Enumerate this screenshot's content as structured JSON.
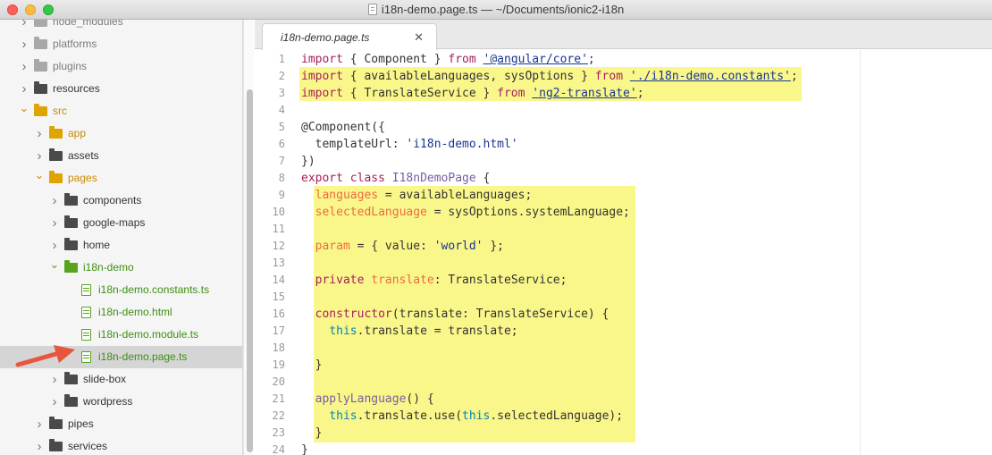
{
  "window": {
    "title": "i18n-demo.page.ts — ~/Documents/ionic2-i18n",
    "icon": "document-icon"
  },
  "sidebar": {
    "items": [
      {
        "label": "node_modules",
        "type": "folder",
        "state": "closed",
        "color": "muted",
        "depth": 1
      },
      {
        "label": "platforms",
        "type": "folder",
        "state": "closed",
        "color": "muted",
        "depth": 1
      },
      {
        "label": "plugins",
        "type": "folder",
        "state": "closed",
        "color": "muted",
        "depth": 1
      },
      {
        "label": "resources",
        "type": "folder",
        "state": "closed",
        "color": "dark",
        "depth": 1
      },
      {
        "label": "src",
        "type": "folder",
        "state": "open",
        "color": "yellow",
        "depth": 1
      },
      {
        "label": "app",
        "type": "folder",
        "state": "closed",
        "color": "yellow",
        "depth": 2
      },
      {
        "label": "assets",
        "type": "folder",
        "state": "closed",
        "color": "dark",
        "depth": 2
      },
      {
        "label": "pages",
        "type": "folder",
        "state": "open",
        "color": "yellow",
        "depth": 2
      },
      {
        "label": "components",
        "type": "folder",
        "state": "closed",
        "color": "dark",
        "depth": 3
      },
      {
        "label": "google-maps",
        "type": "folder",
        "state": "closed",
        "color": "dark",
        "depth": 3
      },
      {
        "label": "home",
        "type": "folder",
        "state": "closed",
        "color": "dark",
        "depth": 3
      },
      {
        "label": "i18n-demo",
        "type": "folder",
        "state": "open",
        "color": "green",
        "depth": 3
      },
      {
        "label": "i18n-demo.constants.ts",
        "type": "file",
        "color": "green",
        "depth": 4
      },
      {
        "label": "i18n-demo.html",
        "type": "file",
        "color": "green",
        "depth": 4
      },
      {
        "label": "i18n-demo.module.ts",
        "type": "file",
        "color": "green",
        "depth": 4
      },
      {
        "label": "i18n-demo.page.ts",
        "type": "file",
        "color": "green",
        "depth": 4,
        "selected": true
      },
      {
        "label": "slide-box",
        "type": "folder",
        "state": "closed",
        "color": "dark",
        "depth": 3
      },
      {
        "label": "wordpress",
        "type": "folder",
        "state": "closed",
        "color": "dark",
        "depth": 3
      },
      {
        "label": "pipes",
        "type": "folder",
        "state": "closed",
        "color": "dark",
        "depth": 2
      },
      {
        "label": "services",
        "type": "folder",
        "state": "closed",
        "color": "dark",
        "depth": 2
      }
    ]
  },
  "tabs": [
    {
      "label": "i18n-demo.page.ts",
      "close_glyph": "✕",
      "active": true
    }
  ],
  "editor": {
    "highlight_color": "#faf78a",
    "lines": [
      {
        "n": "1",
        "tokens": [
          [
            "kw",
            "import"
          ],
          [
            "",
            "{ Component } "
          ],
          [
            "kw",
            "from"
          ],
          [
            "",
            " "
          ],
          [
            "url",
            "'@angular/core'"
          ],
          [
            "",
            ";"
          ]
        ]
      },
      {
        "n": "2",
        "tokens": [
          [
            "kw",
            "import"
          ],
          [
            "",
            "{ availableLanguages, sysOptions } "
          ],
          [
            "kw",
            "from"
          ],
          [
            "",
            " "
          ],
          [
            "url",
            "'./i18n-demo.constants'"
          ],
          [
            "",
            ";"
          ]
        ]
      },
      {
        "n": "3",
        "tokens": [
          [
            "kw",
            "import"
          ],
          [
            "",
            "{ TranslateService } "
          ],
          [
            "kw",
            "from"
          ],
          [
            "",
            " "
          ],
          [
            "url",
            "'ng2-translate'"
          ],
          [
            "",
            ";"
          ]
        ]
      },
      {
        "n": "4",
        "tokens": []
      },
      {
        "n": "5",
        "tokens": [
          [
            "dec",
            "@Component({"
          ]
        ]
      },
      {
        "n": "6",
        "tokens": [
          [
            "",
            "  templateUrl: "
          ],
          [
            "strp",
            "'i18n-demo.html'"
          ]
        ]
      },
      {
        "n": "7",
        "tokens": [
          [
            "",
            "})"
          ]
        ]
      },
      {
        "n": "8",
        "tokens": [
          [
            "kw",
            "export"
          ],
          [
            "",
            " "
          ],
          [
            "kw",
            "class"
          ],
          [
            "",
            " "
          ],
          [
            "cls",
            "I18nDemoPage"
          ],
          [
            "",
            " {"
          ]
        ]
      },
      {
        "n": "9",
        "tokens": [
          [
            "",
            "  "
          ],
          [
            "prop",
            "languages"
          ],
          [
            "",
            " = availableLanguages;"
          ]
        ]
      },
      {
        "n": "10",
        "tokens": [
          [
            "",
            "  "
          ],
          [
            "prop",
            "selectedLanguage"
          ],
          [
            "",
            " = sysOptions.systemLanguage;"
          ]
        ]
      },
      {
        "n": "11",
        "tokens": []
      },
      {
        "n": "12",
        "tokens": [
          [
            "",
            "  "
          ],
          [
            "prop",
            "param"
          ],
          [
            "",
            " = { value: "
          ],
          [
            "strp",
            "'world'"
          ],
          [
            "",
            " };"
          ]
        ]
      },
      {
        "n": "13",
        "tokens": []
      },
      {
        "n": "14",
        "tokens": [
          [
            "",
            "  "
          ],
          [
            "kw",
            "private"
          ],
          [
            "",
            " "
          ],
          [
            "prop",
            "translate"
          ],
          [
            "",
            ": TranslateService;"
          ]
        ]
      },
      {
        "n": "15",
        "tokens": []
      },
      {
        "n": "16",
        "tokens": [
          [
            "",
            "  "
          ],
          [
            "kw",
            "constructor"
          ],
          [
            "",
            "(translate: TranslateService) {"
          ]
        ]
      },
      {
        "n": "17",
        "tokens": [
          [
            "",
            "    "
          ],
          [
            "this",
            "this"
          ],
          [
            "",
            ".translate = translate;"
          ]
        ]
      },
      {
        "n": "18",
        "tokens": []
      },
      {
        "n": "19",
        "tokens": [
          [
            "",
            "  }"
          ]
        ]
      },
      {
        "n": "20",
        "tokens": []
      },
      {
        "n": "21",
        "tokens": [
          [
            "",
            "  "
          ],
          [
            "fn",
            "applyLanguage"
          ],
          [
            "",
            "() {"
          ]
        ]
      },
      {
        "n": "22",
        "tokens": [
          [
            "",
            "    "
          ],
          [
            "this",
            "this"
          ],
          [
            "",
            ".translate.use("
          ],
          [
            "this",
            "this"
          ],
          [
            "",
            ".selectedLanguage);"
          ]
        ]
      },
      {
        "n": "23",
        "tokens": [
          [
            "",
            "  }"
          ]
        ]
      },
      {
        "n": "24",
        "tokens": [
          [
            "",
            "}"
          ]
        ]
      }
    ]
  }
}
